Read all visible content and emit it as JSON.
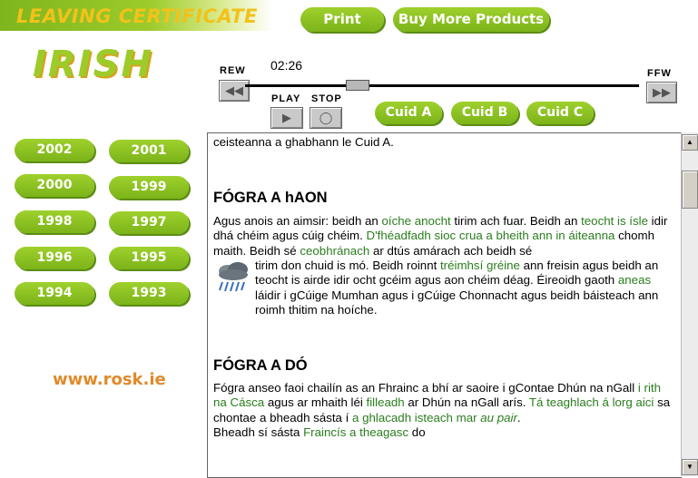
{
  "header": {
    "title": "LEAVING CERTIFICATE",
    "print_label": "Print",
    "buy_label": "Buy More Products"
  },
  "logo": {
    "text": "IRISH"
  },
  "player": {
    "rew_label": "REW",
    "ffw_label": "FFW",
    "time": "02:26",
    "play_label": "PLAY",
    "stop_label": "STOP",
    "position_fraction": 0.27
  },
  "sections": [
    "Cuid A",
    "Cuid B",
    "Cuid C"
  ],
  "years": [
    "2002",
    "2001",
    "2000",
    "1999",
    "1998",
    "1997",
    "1996",
    "1995",
    "1994",
    "1993"
  ],
  "site": "www.rosk.ie",
  "content": {
    "intro": "ceisteanna a ghabhann le Cuid A.",
    "h1": "FÓGRA A hAON",
    "p1": {
      "a": "Agus anois an aimsir: beidh an ",
      "b": "oíche anocht",
      "c": " tirim ach fuar. Beidh an ",
      "d": "teocht is ísle",
      "e": " idir dhá chéim agus cúig chéim. ",
      "f": "D'fhéadfadh sioc crua a bheith ann in áiteanna",
      "g": " chomh maith. Beidh sé ",
      "h": "ceobhránach",
      "i": " ar dtús amárach ach beidh sé"
    },
    "p1b": {
      "a": "tirim don chuid is mó. Beidh roinnt ",
      "b": "tréimhsí gréine",
      "c": " ann freisin agus beidh an teocht is airde idir ocht gcéim agus aon chéim déag. Éireoidh gaoth ",
      "d": "aneas",
      "e": " láidir i gCúige Mumhan agus i gCúige Chonnacht agus beidh báisteach ann roimh thitim na hoíche."
    },
    "h2": "FÓGRA A DÓ",
    "p2": {
      "a": "Fógra anseo faoi chailín as an Fhrainc a bhí ar saoire i gContae Dhún na nGall ",
      "b": "i rith na Cásca",
      "c": " agus ar mhaith léi ",
      "d": "filleadh",
      "e": " ar Dhún na nGall arís. ",
      "f": "Tá teaghlach á lorg aici",
      "g": " sa chontae a bheadh sásta í ",
      "h": "a ghlacadh isteach mar ",
      "i": "au pair",
      "j": ".",
      "k": "Bheadh sí sásta ",
      "l": "Fraincís a theagasc",
      "m": " do"
    }
  },
  "icons": {
    "weather": "rain-cloud-icon"
  },
  "colors": {
    "accent_green": "#8cc022",
    "link_green": "#2a7d1e",
    "title_yellow": "#f2c21a",
    "site_orange": "#e08a2a"
  }
}
